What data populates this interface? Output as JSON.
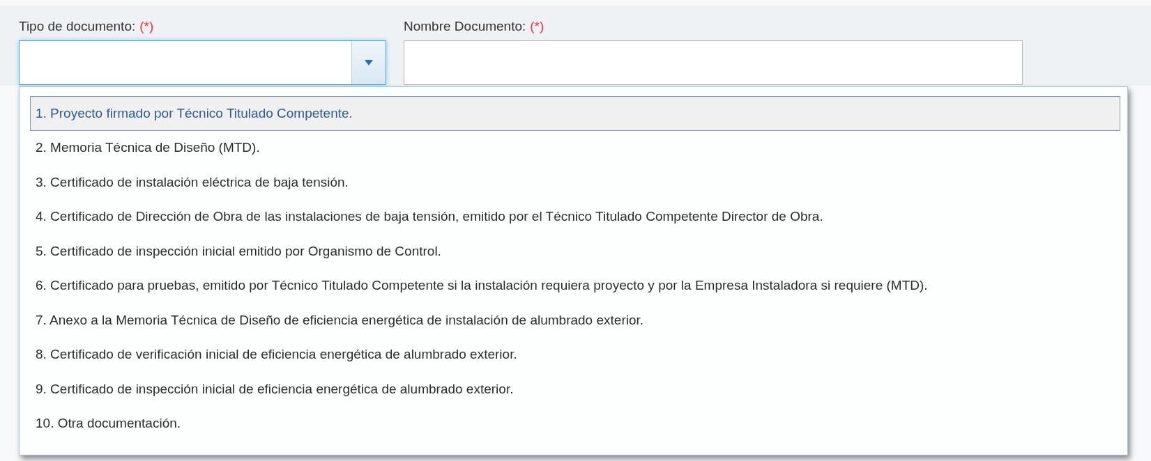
{
  "fields": [
    {
      "label": "Tipo de documento:",
      "required_mark": "(*)",
      "kind": "select",
      "focused": true,
      "expanded": true
    },
    {
      "label": "Nombre Documento:",
      "required_mark": "(*)",
      "kind": "text",
      "focused": false
    }
  ],
  "dropdown": {
    "options": [
      {
        "label": "1. Proyecto firmado por Técnico Titulado Competente.",
        "selected": true
      },
      {
        "label": "2. Memoria Técnica de Diseño (MTD).",
        "selected": false
      },
      {
        "label": "3. Certificado de instalación eléctrica de baja tensión.",
        "selected": false
      },
      {
        "label": "4. Certificado de Dirección de Obra de las instalaciones de baja tensión, emitido por el Técnico Titulado Competente Director de Obra.",
        "selected": false
      },
      {
        "label": "5. Certificado de inspección inicial emitido por Organismo de Control.",
        "selected": false
      },
      {
        "label": "6. Certificado para pruebas, emitido por Técnico Titulado Competente si la instalación requiera proyecto y por la Empresa Instaladora si requiere (MTD).",
        "selected": false
      },
      {
        "label": "7. Anexo a la Memoria Técnica de Diseño de eficiencia energética de instalación de alumbrado exterior.",
        "selected": false
      },
      {
        "label": "8. Certificado de verificación inicial de eficiencia energética de alumbrado exterior.",
        "selected": false
      },
      {
        "label": "9. Certificado de inspección inicial de eficiencia energética de alumbrado exterior.",
        "selected": false
      },
      {
        "label": "10. Otra documentación.",
        "selected": false
      }
    ]
  }
}
